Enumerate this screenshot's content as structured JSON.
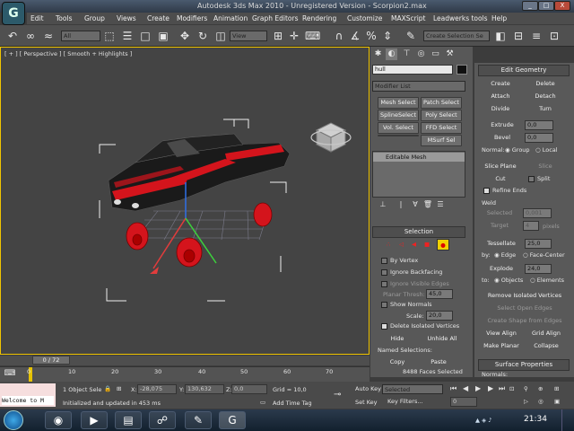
{
  "window": {
    "title": "Autodesk 3ds Max 2010 - Unregistered Version - Scorpion2.max",
    "min": "_",
    "max": "□",
    "close": "X"
  },
  "menu": [
    "Edit",
    "Tools",
    "Group",
    "Views",
    "Create",
    "Modifiers",
    "Animation",
    "Graph Editors",
    "Rendering",
    "Customize",
    "MAXScript",
    "Leadwerks tools",
    "Help"
  ],
  "toolbar": {
    "filter": "All",
    "refcoord": "View",
    "named_selection": "Create Selection Se"
  },
  "viewport": {
    "label": "[ + ] [ Perspective ] [ Smooth + Highlights ]"
  },
  "modify_panel": {
    "object_name": "hull",
    "modifier_list": "Modifier List",
    "mod_buttons": [
      "Mesh Select",
      "Patch Select",
      "SplineSelect",
      "Poly Select",
      "Vol. Select",
      "FFD Select",
      "",
      "MSurf Sel"
    ],
    "stack_item": "Editable Mesh",
    "selection": {
      "title": "Selection",
      "by_vertex": "By Vertex",
      "ignore_backfacing": "Ignore Backfacing",
      "ignore_visible_edges": "Ignore Visible Edges",
      "planar_thresh": "Planar Thresh:",
      "planar_val": "45,0",
      "show_normals": "Show Normals",
      "scale_label": "Scale:",
      "scale_val": "20,0",
      "delete_isolated": "Delete Isolated Vertices",
      "hide": "Hide",
      "unhide": "Unhide All",
      "named": "Named Selections:",
      "copy": "Copy",
      "paste": "Paste",
      "status": "8488 Faces Selected"
    }
  },
  "edit_geometry": {
    "title": "Edit Geometry",
    "create": "Create",
    "delete": "Delete",
    "attach": "Attach",
    "detach": "Detach",
    "divide": "Divide",
    "turn": "Turn",
    "extrude": "Extrude",
    "extrude_val": "0,0",
    "bevel": "Bevel",
    "bevel_val": "0,0",
    "normal_label": "Normal:",
    "group": "Group",
    "local": "Local",
    "slice_plane": "Slice Plane",
    "slice": "Slice",
    "cut": "Cut",
    "split": "Split",
    "refine_ends": "Refine Ends",
    "weld": "Weld",
    "selected": "Selected",
    "selected_val": "0,001",
    "target": "Target",
    "target_val": "4",
    "pixels": "pixels",
    "tessellate": "Tessellate",
    "tess_val": "25,0",
    "by_label": "by:",
    "edge": "Edge",
    "face_center": "Face-Center",
    "explode": "Explode",
    "explode_val": "24,0",
    "to_label": "to:",
    "objects": "Objects",
    "elements": "Elements",
    "remove_isolated": "Remove Isolated Vertices",
    "select_open": "Select Open Edges",
    "create_shape": "Create Shape from Edges",
    "view_align": "View Align",
    "grid_align": "Grid Align",
    "make_planar": "Make Planar",
    "collapse": "Collapse",
    "surface_props": "Surface Properties",
    "normals": "Normals:"
  },
  "timeline": {
    "frame": "0 / 72",
    "ticks": [
      "0",
      "10",
      "20",
      "30",
      "40",
      "50",
      "60",
      "70"
    ]
  },
  "status": {
    "selected": "1 Object Sele",
    "x_label": "X:",
    "x": "-28,075",
    "y_label": "Y:",
    "y": "130,632",
    "z_label": "Z:",
    "z": "0,0",
    "grid": "Grid = 10,0",
    "auto_key": "Auto Key",
    "set_key": "Set Key",
    "key_mode": "Selected",
    "key_filters": "Key Filters...",
    "frame_val": "0",
    "message": "Initialized and updated in 453 ms",
    "add_time_tag": "Add Time Tag",
    "welcome": "Welcome to M"
  },
  "taskbar": {
    "clock": "21:34"
  },
  "colors": {
    "accent": "#f0c400",
    "car_red": "#d4141c"
  }
}
